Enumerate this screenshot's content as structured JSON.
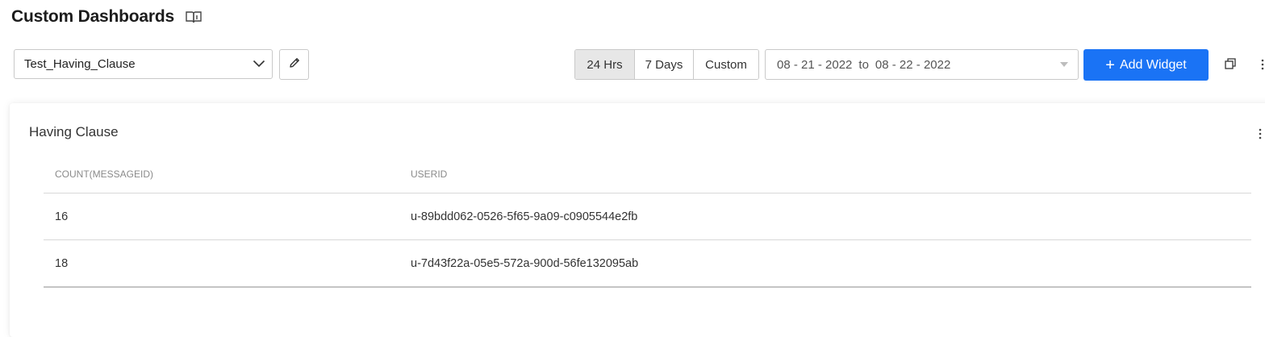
{
  "header": {
    "title": "Custom Dashboards",
    "help_icon": "book-icon"
  },
  "toolbar": {
    "dashboard_select": {
      "value": "Test_Having_Clause",
      "icon": "chevron-down-icon"
    },
    "edit_icon": "pencil-icon",
    "range_buttons": [
      {
        "label": "24 Hrs",
        "active": true
      },
      {
        "label": "7 Days",
        "active": false
      },
      {
        "label": "Custom",
        "active": false
      }
    ],
    "date_range": {
      "from": "08 - 21 - 2022",
      "separator": "to",
      "to": "08 - 22 - 2022"
    },
    "add_widget_label": "Add Widget",
    "add_widget_icon": "plus-icon",
    "expand_icon": "expand-icon",
    "more_icon": "more-vertical-icon"
  },
  "widget": {
    "title": "Having Clause",
    "more_icon": "more-vertical-icon",
    "table": {
      "columns": [
        "COUNT(MESSAGEID)",
        "USERID"
      ],
      "rows": [
        [
          "16",
          "u-89bdd062-0526-5f65-9a09-c0905544e2fb"
        ],
        [
          "18",
          "u-7d43f22a-05e5-572a-900d-56fe132095ab"
        ]
      ]
    }
  },
  "colors": {
    "accent": "#1a73f5",
    "active_range_bg": "#e7e7e7",
    "border": "#c9c9c9"
  }
}
